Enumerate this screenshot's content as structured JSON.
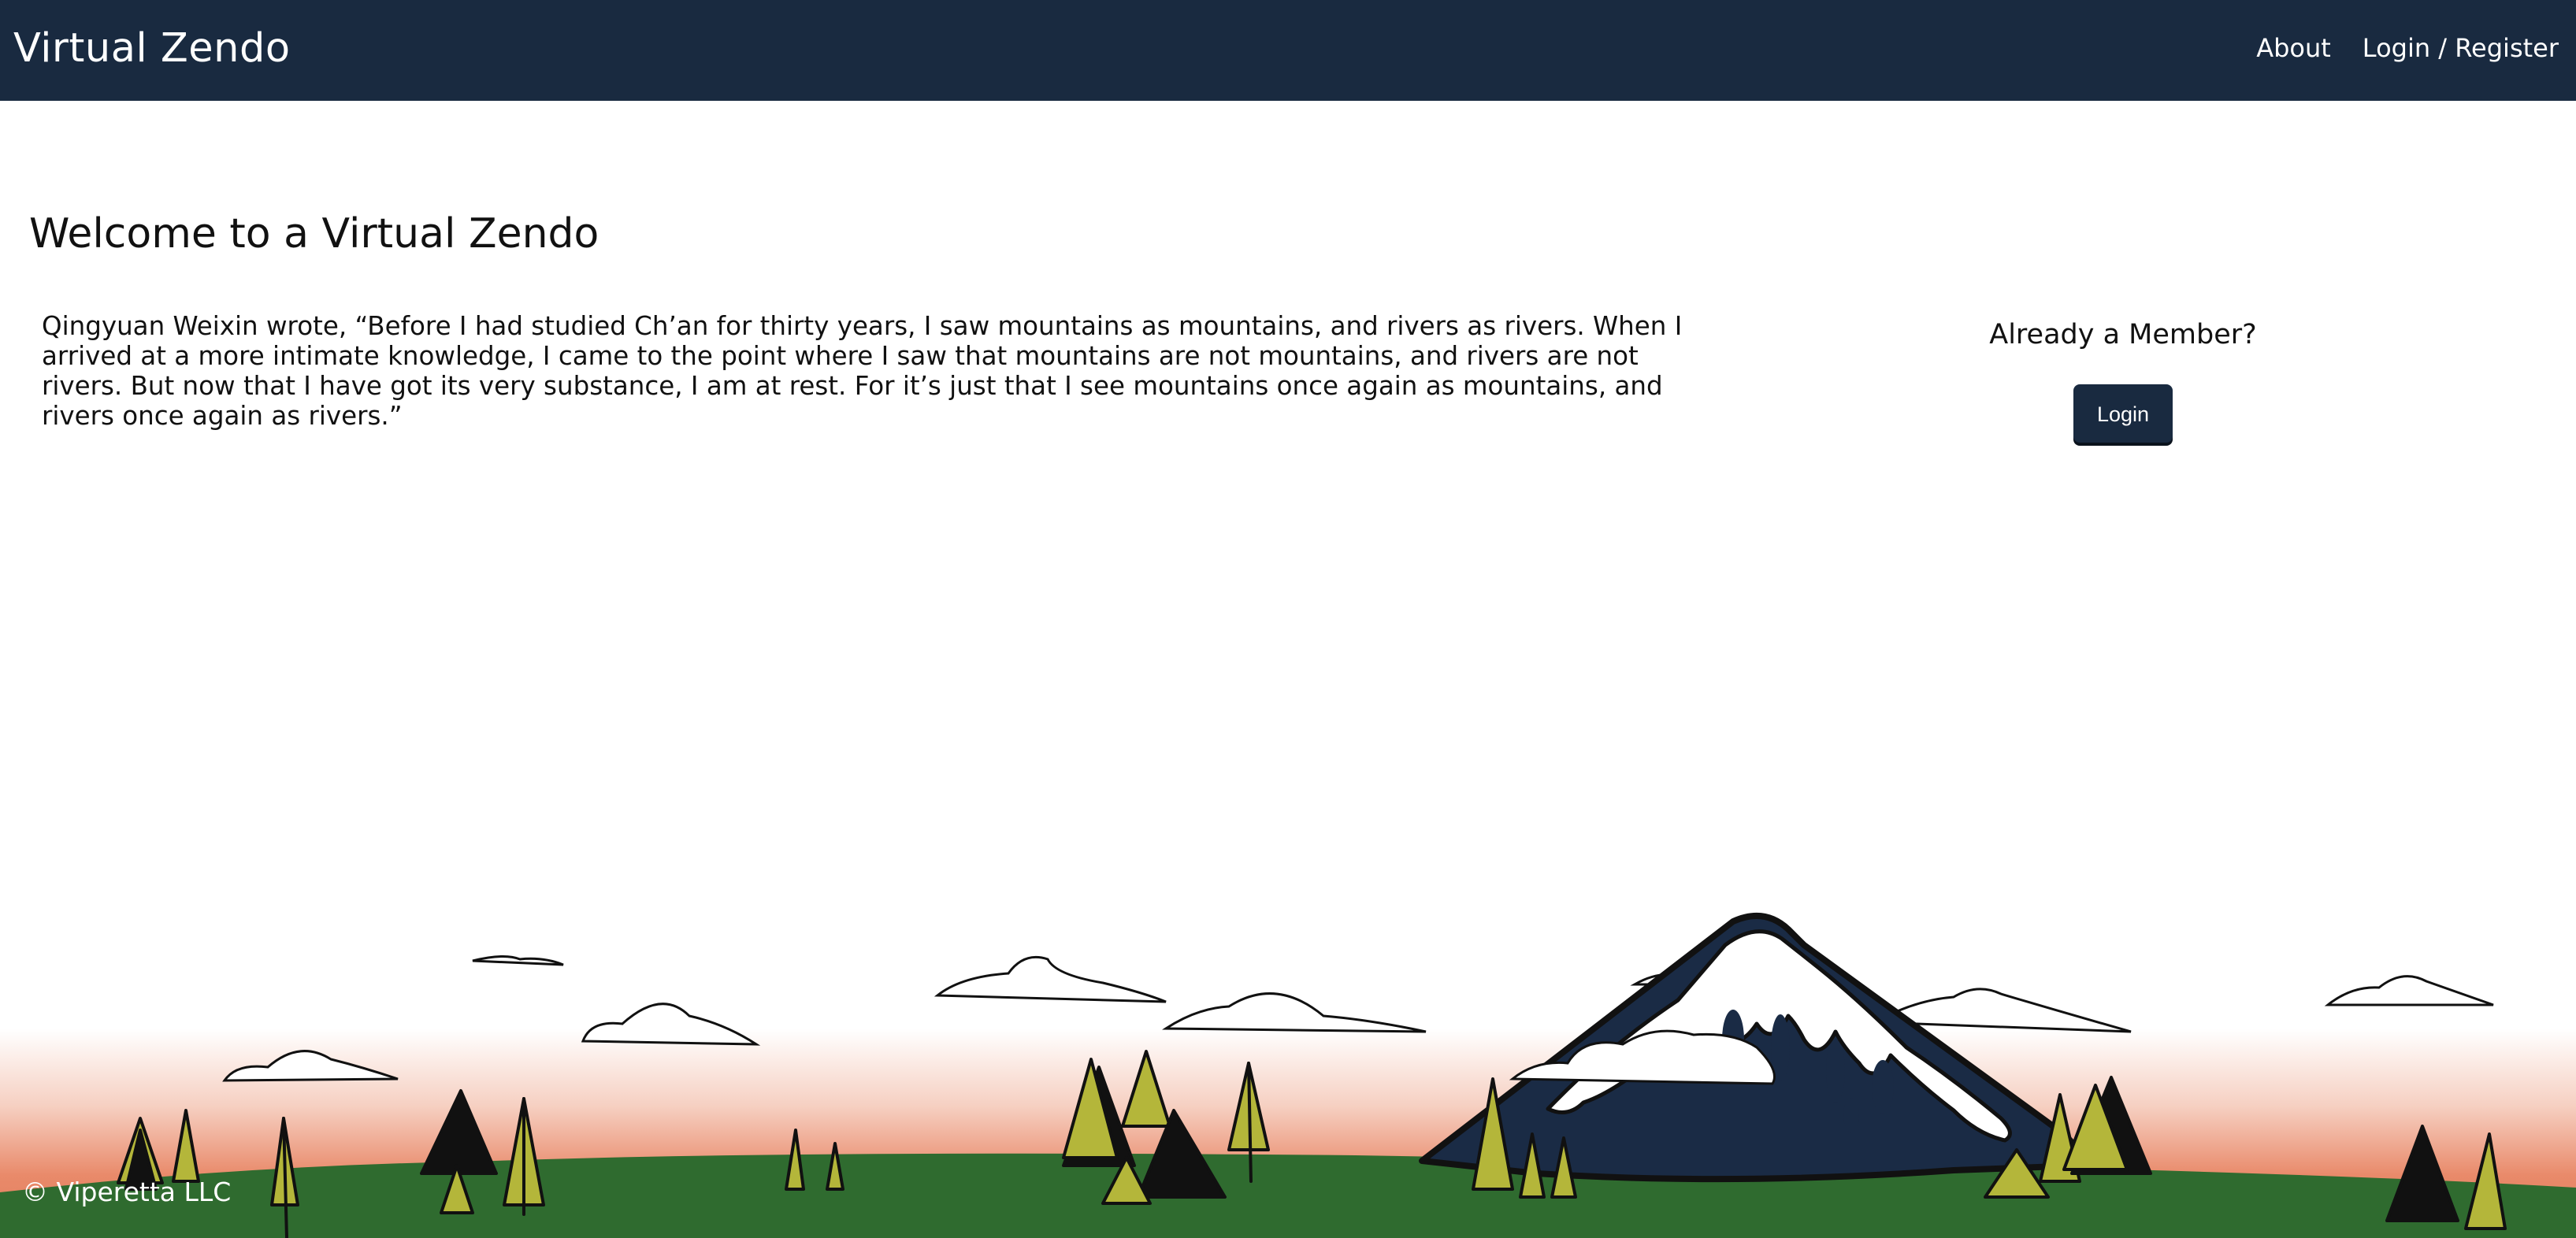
{
  "navbar": {
    "brand": "Virtual Zendo",
    "links": [
      {
        "label": "About"
      },
      {
        "label": "Login / Register"
      }
    ]
  },
  "main": {
    "title": "Welcome to a Virtual Zendo",
    "quote": "Qingyuan Weixin wrote, “Before I had studied Ch’an for thirty years, I saw mountains as mountains, and rivers as rivers. When I arrived at a more intimate knowledge, I came to the point where I saw that mountains are not mountains, and rivers are not rivers. But now that I have got its very substance, I am at rest. For it’s just that I see mountains once again as mountains, and rivers once again as rivers.”"
  },
  "member_box": {
    "heading": "Already a Member?",
    "login_label": "Login"
  },
  "footer": {
    "copyright": "© Viperetta LLC"
  },
  "colors": {
    "navbar": "#192a40",
    "button": "#192a40",
    "hill": "#2f6b2f",
    "sunset": "#e98a6a",
    "mountain": "#1a2b45",
    "tree_accent": "#b4b63a"
  }
}
